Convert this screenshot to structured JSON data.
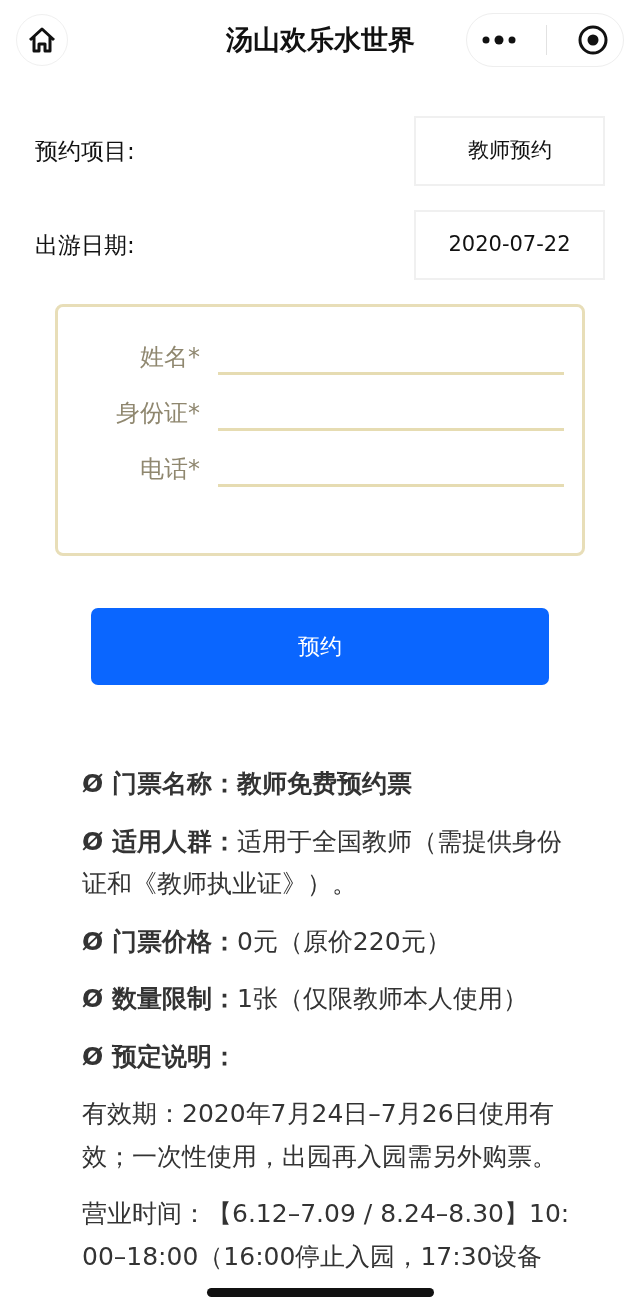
{
  "header": {
    "title": "汤山欢乐水世界"
  },
  "fields": [
    {
      "label": "预约项目:",
      "value": "教师预约"
    },
    {
      "label": "出游日期:",
      "value": "2020-07-22"
    }
  ],
  "form": {
    "inputs": [
      {
        "label": "姓名*"
      },
      {
        "label": "身份证*"
      },
      {
        "label": "电话*"
      }
    ]
  },
  "submit_button": "预约",
  "details": [
    {
      "text": "**Ø 门票名称：教师免费预约票**"
    },
    {
      "text": "**Ø 适用人群：**适用于全国教师（需提供身份证和《教师执业证》）。"
    },
    {
      "text": "**Ø 门票价格：**0元（原价220元）"
    },
    {
      "text": "**Ø 数量限制：**1张（仅限教师本人使用）"
    },
    {
      "text": "**Ø 预定说明：**"
    },
    {
      "text": "有效期：2020年7月24日–7月26日使用有效；一次性使用，出园再入园需另外购票。"
    },
    {
      "text": "营业时间：【6.12–7.09 / 8.24–8.30】10:\n00–18:00（16:00停止入园，17:30设备"
    }
  ]
}
